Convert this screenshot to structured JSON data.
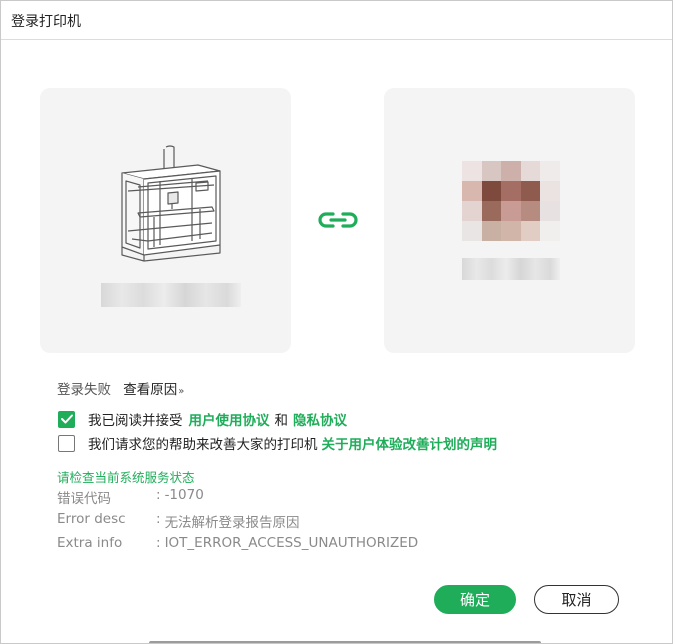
{
  "window": {
    "title": "登录打印机"
  },
  "status": {
    "fail_text": "登录失败",
    "reason_link": "查看原因",
    "reason_chevron": "»"
  },
  "agreements": {
    "row1": {
      "checked": true,
      "prefix": "我已阅读并接受",
      "link1": "用户使用协议",
      "middle": "和",
      "link2": "隐私协议"
    },
    "row2": {
      "checked": false,
      "prefix": "我们请求您的帮助来改善大家的打印机",
      "link": "关于用户体验改善计划的声明"
    }
  },
  "error_info": {
    "title": "请检查当前系统服务状态",
    "rows": [
      {
        "key": "错误代码",
        "sep": ":",
        "value": "-1070"
      },
      {
        "key": "Error desc",
        "sep": ":",
        "value": "无法解析登录报告原因"
      },
      {
        "key": "Extra info",
        "sep": ":",
        "value": "IOT_ERROR_ACCESS_UNAUTHORIZED"
      }
    ]
  },
  "buttons": {
    "ok": "确定",
    "cancel": "取消"
  },
  "icons": {
    "printer": "printer-icon",
    "link": "link-icon",
    "avatar": "avatar-image",
    "check": "check-icon"
  },
  "colors": {
    "accent": "#1fad5a",
    "card_bg": "#f4f4f4",
    "muted_text": "#8a8a8a"
  }
}
